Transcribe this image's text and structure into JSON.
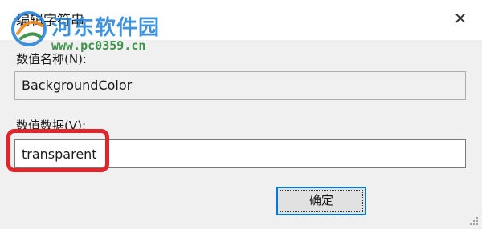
{
  "window": {
    "title": "编辑字符串",
    "close_glyph": "✕"
  },
  "watermark": {
    "name": "河东软件园",
    "url": "www.pc0359.cn",
    "logo_icon": "watermark-logo-icon"
  },
  "fields": {
    "name_label": "数值名称(N):",
    "name_value": "BackgroundColor",
    "data_label": "数值数据(V):",
    "data_value": "transparent"
  },
  "buttons": {
    "ok_label": "确定"
  },
  "colors": {
    "highlight_border": "#e0252b",
    "focus_border": "#0078d7",
    "watermark_blue": "#1e7fd6",
    "watermark_green": "#2e8b3d"
  }
}
